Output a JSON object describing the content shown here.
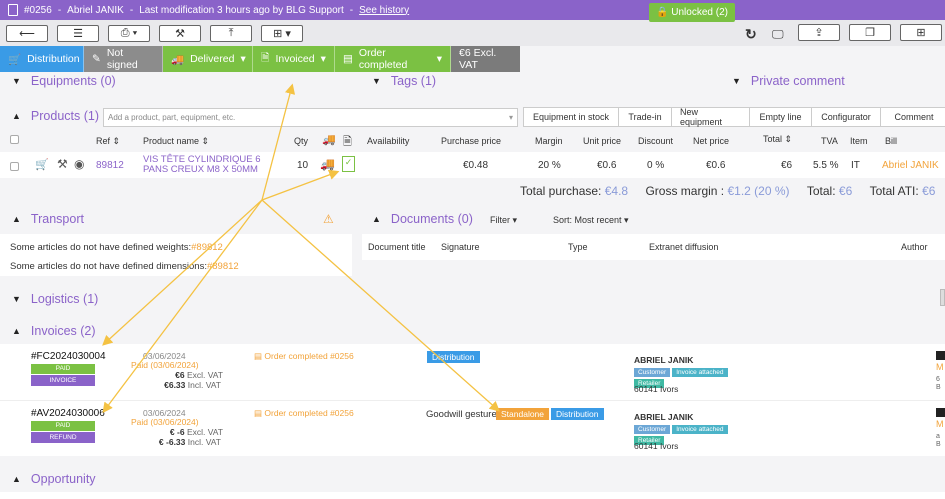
{
  "topbar": {
    "ref": "#0256",
    "dash1": "-",
    "user": "Abriel JANIK",
    "dash2": "-",
    "modif": "Last modification 3 hours ago by BLG Support",
    "dash3": "-",
    "history": "See history"
  },
  "toolbar": {
    "unlocked": "Unlocked (2)"
  },
  "status": {
    "distribution": "Distribution",
    "not_signed": "Not signed",
    "delivered": "Delivered",
    "invoiced": "Invoiced",
    "order_completed": "Order completed",
    "excl": "€6 Excl. VAT"
  },
  "sections": {
    "equipments": "Equipments (0)",
    "tags": "Tags (1)",
    "private": "Private comment",
    "products": "Products (1)",
    "transport": "Transport",
    "documents": "Documents (0)",
    "logistics": "Logistics (1)",
    "invoices": "Invoices (2)",
    "opportunity": "Opportunity"
  },
  "products": {
    "search_placeholder": "Add a product, part, equipment, etc.",
    "buttons": [
      "Equipment in stock",
      "Trade-in",
      "New equipment",
      "Empty line",
      "Configurator",
      "Comment"
    ],
    "columns": {
      "ref": "Ref ⇕",
      "name": "Product name ⇕",
      "qty": "Qty",
      "availability": "Availability",
      "purchase": "Purchase price",
      "margin": "Margin",
      "unit": "Unit price",
      "discount": "Discount",
      "net": "Net price",
      "total": "Total ⇕",
      "tva": "TVA",
      "item": "Item",
      "bill": "Bill"
    },
    "row": {
      "ref": "89812",
      "name": "VIS TÊTE CYLINDRIQUE 6 PANS CREUX M8 X 50MM",
      "qty": "10",
      "purchase": "€0.48",
      "margin": "20 %",
      "unit": "€0.6",
      "discount": "0 %",
      "net": "€0.6",
      "total": "€6",
      "tva": "5.5 %",
      "item": "IT",
      "bill": "Abriel JANIK"
    },
    "totals": {
      "purchase_label": "Total purchase:",
      "purchase_value": "€4.8",
      "margin_label": "Gross margin :",
      "margin_value": "€1.2 (20 %)",
      "total_label": "Total:",
      "total_value": "€6",
      "ati_label": "Total ATI:",
      "ati_value": "€6"
    }
  },
  "transport": {
    "warn1": "Some articles do not have defined weights:",
    "warn1_ref": "#89812",
    "warn2": "Some articles do not have defined dimensions:",
    "warn2_ref": "#89812"
  },
  "documents": {
    "filter": "Filter ▾",
    "sort": "Sort: Most recent ▾",
    "cols": {
      "title": "Document title",
      "signature": "Signature",
      "type": "Type",
      "extranet": "Extranet diffusion",
      "author": "Author"
    }
  },
  "invoices": [
    {
      "number": "#FC2024030004",
      "status": "PAID",
      "kind": "INVOICE",
      "date": "03/06/2024",
      "paid": "Paid (03/06/2024)",
      "excl_amount": "€6",
      "excl_label": "Excl. VAT",
      "incl_amount": "€6.33",
      "incl_label": "Incl. VAT",
      "order": "Order completed #0256",
      "label": "",
      "tags": [
        "Distribution"
      ],
      "client": "ABRIEL JANIK",
      "badges": [
        "Customer",
        "Invoice attached",
        "Retailer"
      ],
      "address": "60141 Ivors",
      "right1": "M",
      "right2": "6",
      "right3": "B"
    },
    {
      "number": "#AV2024030006",
      "status": "PAID",
      "kind": "REFUND",
      "date": "03/06/2024",
      "paid": "Paid (03/06/2024)",
      "excl_amount": "€ -6",
      "excl_label": "Excl. VAT",
      "incl_amount": "€ -6.33",
      "incl_label": "Incl. VAT",
      "order": "Order completed #0256",
      "label": "Goodwill gesture",
      "tags": [
        "Standalone",
        "Distribution"
      ],
      "client": "ABRIEL JANIK",
      "badges": [
        "Customer",
        "Invoice attached",
        "Retailer"
      ],
      "address": "60141 Ivors",
      "right1": "M",
      "right2": "a",
      "right3": "B"
    }
  ],
  "colors": {
    "purple": "#8a63c9",
    "blue": "#3a9be6",
    "green": "#7bc143",
    "orange": "#f2a33a",
    "arrow": "#f4c243"
  }
}
